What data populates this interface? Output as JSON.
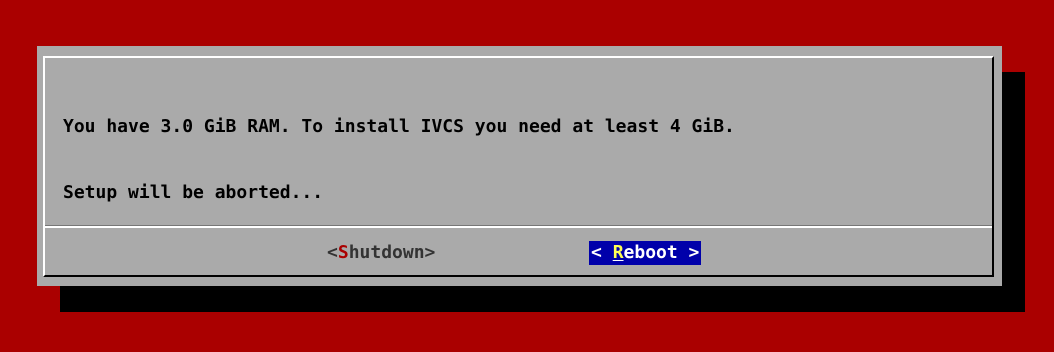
{
  "screen": {
    "background_color": "#aa0000",
    "dialog_color": "#aaaaaa",
    "shadow_color": "#000000"
  },
  "dialog": {
    "message_lines": [
      "You have 3.0 GiB RAM. To install IVCS you need at least 4 GiB.",
      "Setup will be aborted..."
    ],
    "buttons": {
      "shutdown": {
        "open_bracket": "<",
        "hotkey": "S",
        "rest": "hutdown",
        "close_bracket": ">"
      },
      "reboot": {
        "open_bracket": "< ",
        "hotkey": "R",
        "rest": "eboot",
        "close_bracket": " >",
        "selected": true,
        "selected_color": "#0000aa"
      }
    }
  }
}
